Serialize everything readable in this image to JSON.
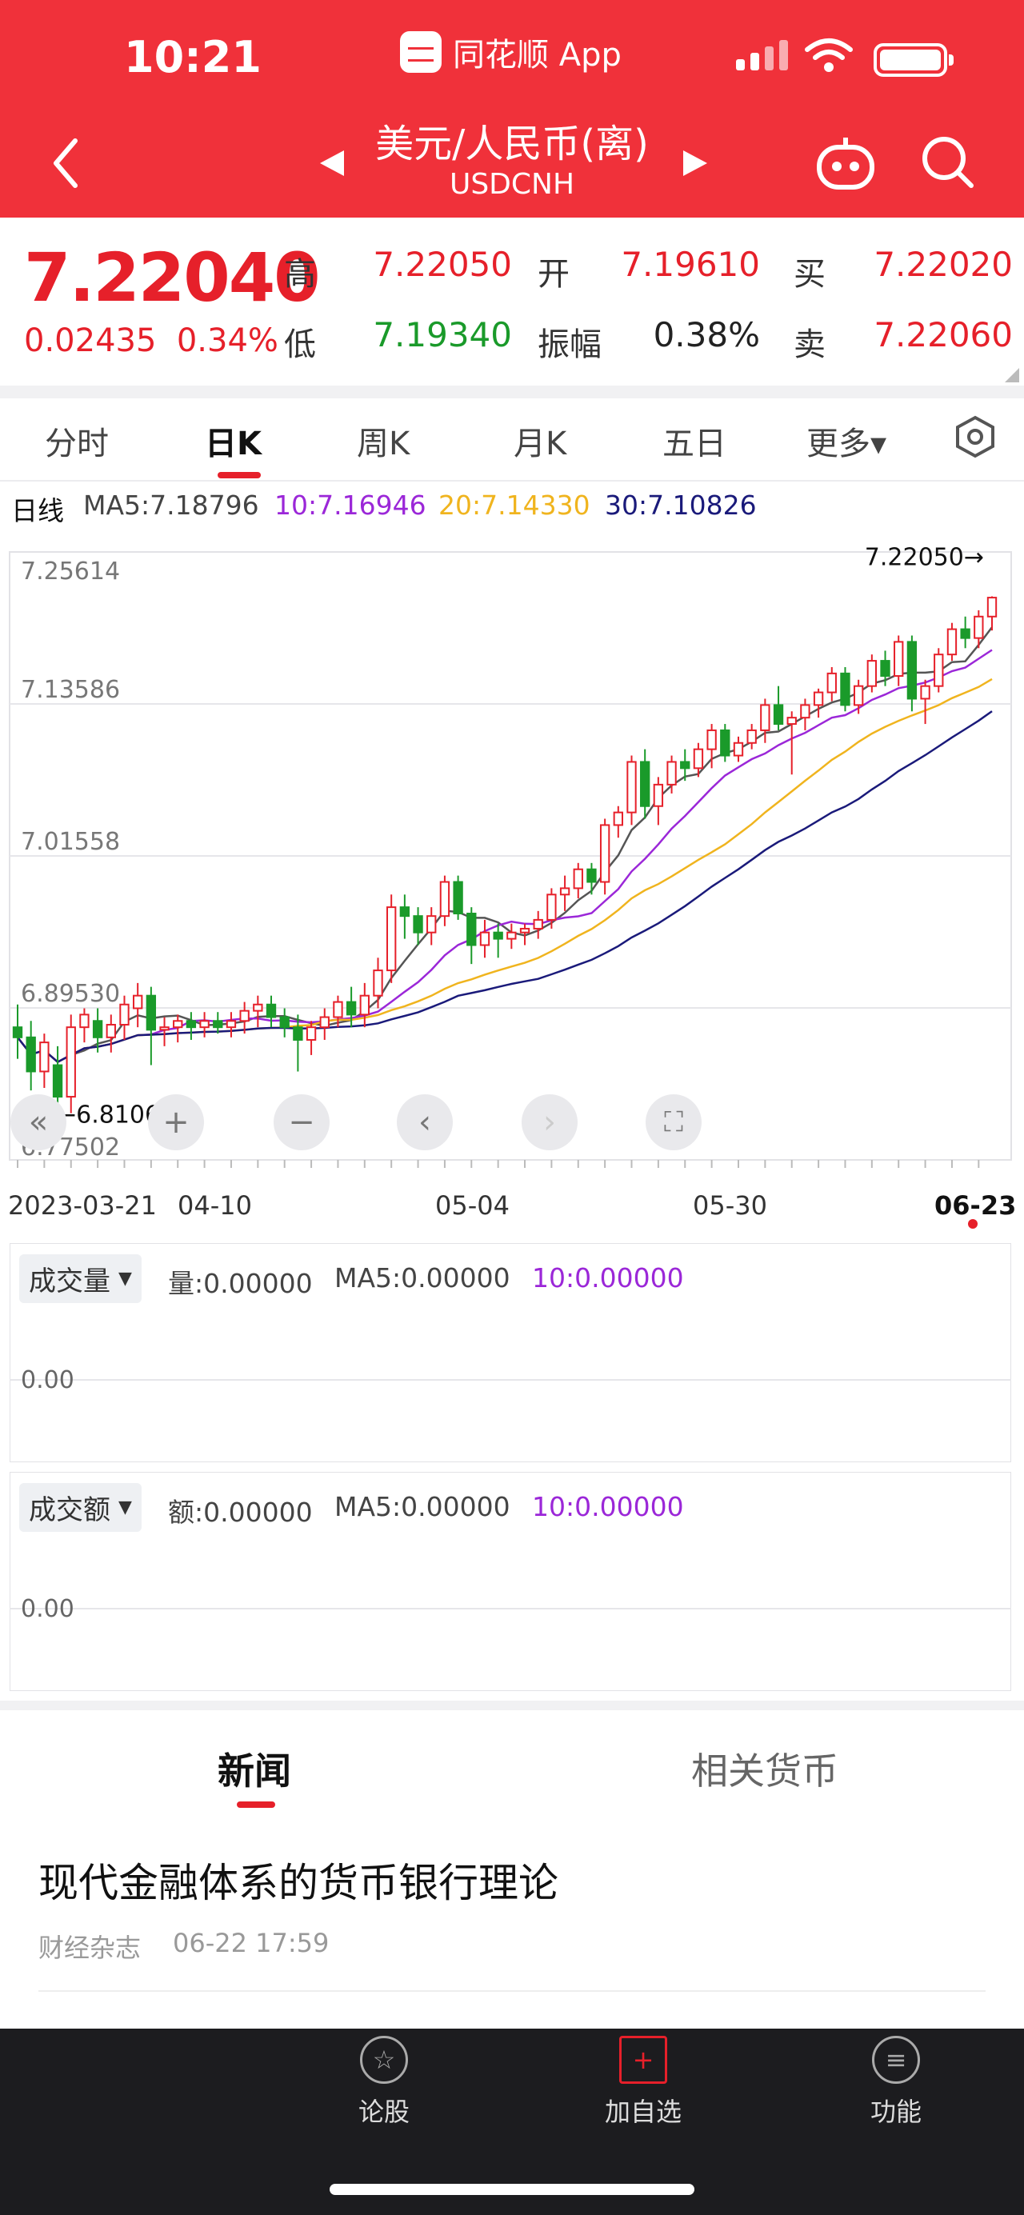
{
  "status_bar": {
    "time": "10:21",
    "app_name": "同花顺 App"
  },
  "header": {
    "title": "美元/人民币(离)",
    "subtitle": "USDCNH"
  },
  "quote": {
    "price": "7.22040",
    "change": "0.02435",
    "change_pct": "0.34%",
    "labels": {
      "high": "高",
      "low": "低",
      "open": "开",
      "amplitude": "振幅",
      "buy": "买",
      "sell": "卖"
    },
    "high": "7.22050",
    "low": "7.19340",
    "open": "7.19610",
    "amplitude": "0.38%",
    "buy": "7.22020",
    "sell": "7.22060"
  },
  "tabs": [
    "分时",
    "日K",
    "周K",
    "月K",
    "五日",
    "更多▾"
  ],
  "active_tab": 1,
  "ma_legend": {
    "period": "日线",
    "ma5": "MA5:7.18796",
    "ma10": "10:7.16946",
    "ma20": "20:7.14330",
    "ma30": "30:7.10826"
  },
  "colors": {
    "up": "#e6202a",
    "down": "#1a9a2a",
    "ma5": "#555555",
    "ma10": "#9b27d8",
    "ma20": "#f0b41e",
    "ma30": "#1a1a7a"
  },
  "chart_data": {
    "type": "candlestick",
    "y_ticks": [
      "7.25614",
      "7.13586",
      "7.01558",
      "6.89530",
      "6.77502"
    ],
    "ylim": [
      6.77502,
      7.25614
    ],
    "x_tick_labels": [
      "2023-03-21",
      "04-10",
      "05-04",
      "05-30",
      "06-23"
    ],
    "max_label": "7.22050→",
    "min_label": "←6.81065",
    "candles": [
      [
        6.88,
        6.898,
        6.855,
        6.872
      ],
      [
        6.872,
        6.885,
        6.83,
        6.845
      ],
      [
        6.845,
        6.875,
        6.832,
        6.868
      ],
      [
        6.85,
        6.865,
        6.81,
        6.825
      ],
      [
        6.825,
        6.89,
        6.812,
        6.88
      ],
      [
        6.88,
        6.895,
        6.868,
        6.89
      ],
      [
        6.885,
        6.895,
        6.86,
        6.872
      ],
      [
        6.872,
        6.89,
        6.86,
        6.882
      ],
      [
        6.882,
        6.905,
        6.87,
        6.898
      ],
      [
        6.895,
        6.915,
        6.88,
        6.905
      ],
      [
        6.905,
        6.912,
        6.85,
        6.878
      ],
      [
        6.878,
        6.888,
        6.865,
        6.88
      ],
      [
        6.88,
        6.89,
        6.868,
        6.885
      ],
      [
        6.885,
        6.892,
        6.87,
        6.88
      ],
      [
        6.88,
        6.892,
        6.872,
        6.885
      ],
      [
        6.885,
        6.892,
        6.875,
        6.88
      ],
      [
        6.88,
        6.892,
        6.872,
        6.885
      ],
      [
        6.885,
        6.9,
        6.875,
        6.893
      ],
      [
        6.893,
        6.905,
        6.88,
        6.898
      ],
      [
        6.898,
        6.905,
        6.88,
        6.888
      ],
      [
        6.888,
        6.895,
        6.872,
        6.88
      ],
      [
        6.88,
        6.89,
        6.845,
        6.87
      ],
      [
        6.87,
        6.885,
        6.858,
        6.88
      ],
      [
        6.88,
        6.895,
        6.87,
        6.888
      ],
      [
        6.888,
        6.905,
        6.88,
        6.9
      ],
      [
        6.9,
        6.912,
        6.88,
        6.89
      ],
      [
        6.89,
        6.915,
        6.88,
        6.905
      ],
      [
        6.905,
        6.935,
        6.895,
        6.925
      ],
      [
        6.925,
        6.985,
        6.915,
        6.975
      ],
      [
        6.975,
        6.985,
        6.95,
        6.968
      ],
      [
        6.968,
        6.975,
        6.945,
        6.955
      ],
      [
        6.955,
        6.975,
        6.945,
        6.968
      ],
      [
        6.968,
        7.0,
        6.96,
        6.995
      ],
      [
        6.995,
        7.0,
        6.965,
        6.97
      ],
      [
        6.97,
        6.975,
        6.93,
        6.945
      ],
      [
        6.945,
        6.965,
        6.935,
        6.955
      ],
      [
        6.955,
        6.962,
        6.935,
        6.95
      ],
      [
        6.95,
        6.962,
        6.942,
        6.955
      ],
      [
        6.955,
        6.962,
        6.945,
        6.958
      ],
      [
        6.958,
        6.972,
        6.95,
        6.965
      ],
      [
        6.965,
        6.99,
        6.958,
        6.985
      ],
      [
        6.985,
        7.0,
        6.972,
        6.99
      ],
      [
        6.99,
        7.01,
        6.982,
        7.005
      ],
      [
        7.005,
        7.01,
        6.985,
        6.995
      ],
      [
        6.995,
        7.045,
        6.985,
        7.04
      ],
      [
        7.04,
        7.055,
        7.03,
        7.05
      ],
      [
        7.05,
        7.095,
        7.04,
        7.09
      ],
      [
        7.09,
        7.1,
        7.045,
        7.055
      ],
      [
        7.055,
        7.078,
        7.04,
        7.072
      ],
      [
        7.072,
        7.095,
        7.065,
        7.09
      ],
      [
        7.09,
        7.1,
        7.075,
        7.085
      ],
      [
        7.085,
        7.105,
        7.078,
        7.1
      ],
      [
        7.1,
        7.12,
        7.085,
        7.115
      ],
      [
        7.115,
        7.12,
        7.09,
        7.095
      ],
      [
        7.095,
        7.11,
        7.09,
        7.105
      ],
      [
        7.105,
        7.12,
        7.1,
        7.115
      ],
      [
        7.115,
        7.14,
        7.105,
        7.135
      ],
      [
        7.135,
        7.15,
        7.115,
        7.12
      ],
      [
        7.12,
        7.13,
        7.08,
        7.125
      ],
      [
        7.125,
        7.14,
        7.115,
        7.135
      ],
      [
        7.135,
        7.148,
        7.125,
        7.145
      ],
      [
        7.145,
        7.165,
        7.138,
        7.16
      ],
      [
        7.16,
        7.165,
        7.13,
        7.135
      ],
      [
        7.135,
        7.155,
        7.128,
        7.15
      ],
      [
        7.15,
        7.175,
        7.145,
        7.17
      ],
      [
        7.17,
        7.178,
        7.15,
        7.158
      ],
      [
        7.158,
        7.19,
        7.15,
        7.185
      ],
      [
        7.185,
        7.19,
        7.13,
        7.14
      ],
      [
        7.14,
        7.155,
        7.12,
        7.15
      ],
      [
        7.15,
        7.18,
        7.145,
        7.175
      ],
      [
        7.175,
        7.2,
        7.17,
        7.195
      ],
      [
        7.195,
        7.205,
        7.18,
        7.188
      ],
      [
        7.188,
        7.21,
        7.18,
        7.205
      ],
      [
        7.205,
        7.221,
        7.194,
        7.22
      ]
    ]
  },
  "controls": {
    "collapse": "«",
    "zoom_in": "+",
    "zoom_out": "−",
    "prev": "‹",
    "next": "›",
    "fullscreen": "⛶"
  },
  "volume_panel": {
    "title": "成交量",
    "stat": "量:0.00000",
    "ma5": "MA5:0.00000",
    "ma10": "10:0.00000",
    "tick": "0.00"
  },
  "amount_panel": {
    "title": "成交额",
    "stat": "额:0.00000",
    "ma5": "MA5:0.00000",
    "ma10": "10:0.00000",
    "tick": "0.00"
  },
  "news_tabs": [
    "新闻",
    "相关货币"
  ],
  "news": [
    {
      "title": "现代金融体系的货币银行理论",
      "source": "财经杂志",
      "time": "06-22 17:59"
    }
  ],
  "bottom_nav": [
    {
      "label": "论股",
      "icon": "☆"
    },
    {
      "label": "加自选",
      "icon": "+"
    },
    {
      "label": "功能",
      "icon": "≡"
    }
  ]
}
